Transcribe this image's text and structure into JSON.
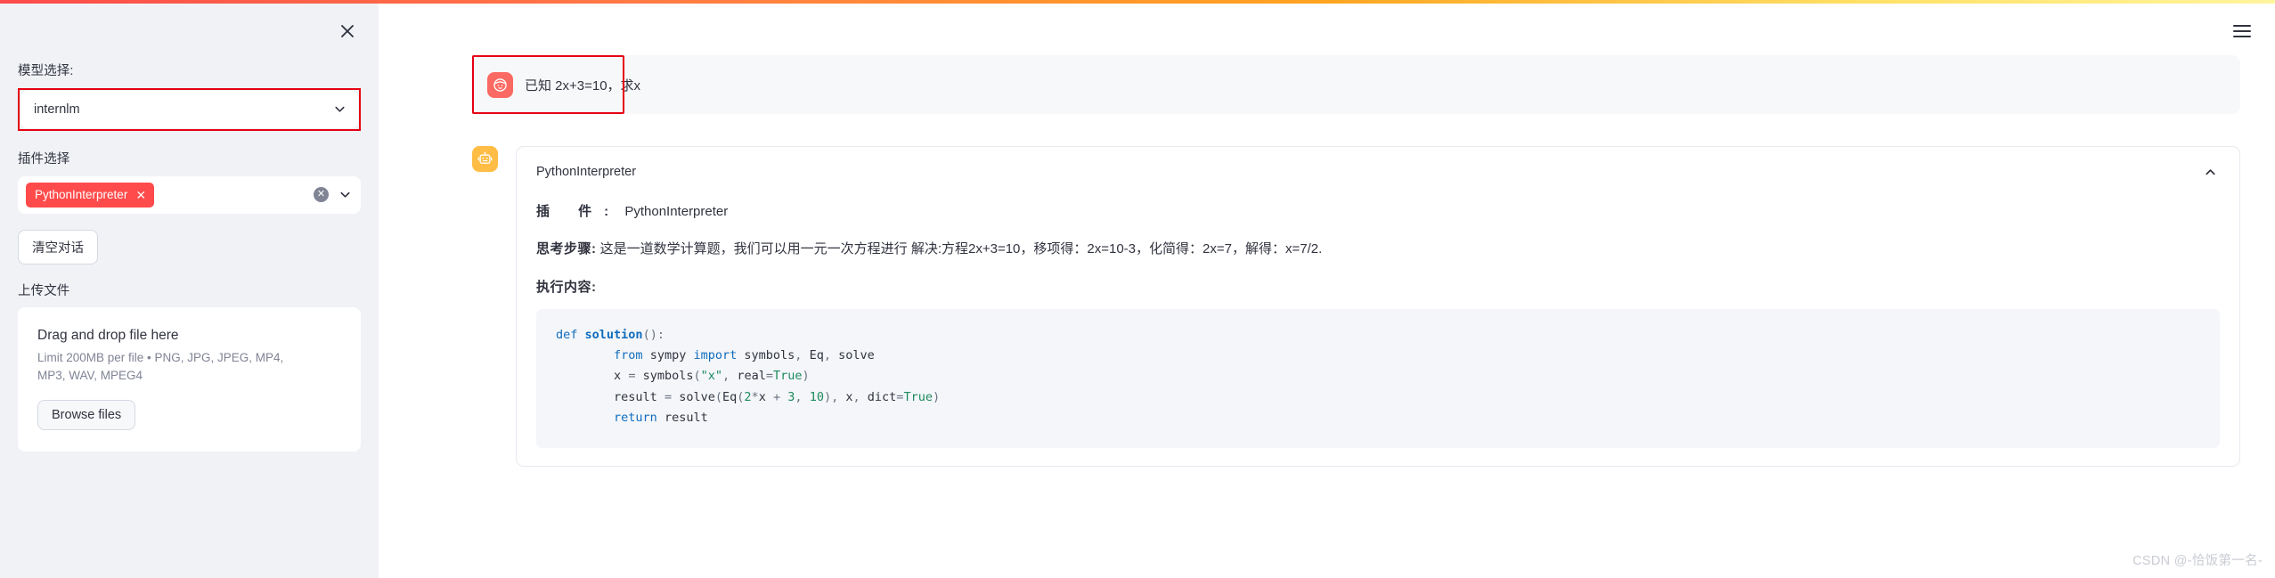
{
  "window": {
    "hamburger_icon": "hamburger-menu-icon",
    "top_accent_colors": [
      "#ff4b4b",
      "#ffa421",
      "#fff59d"
    ]
  },
  "sidebar": {
    "close_icon": "close-icon",
    "model": {
      "label": "模型选择:",
      "selected": "internlm",
      "arrow_icon": "chevron-down-icon",
      "annotation_color": "#e60012"
    },
    "plugins": {
      "label": "插件选择",
      "tags": [
        "PythonInterpreter"
      ],
      "tag_remove_icon": "close-icon",
      "clear_icon": "clear-all-icon",
      "arrow_icon": "chevron-down-icon",
      "tag_color": "#ff4b4b"
    },
    "clear_conversation_label": "清空对话",
    "upload": {
      "label": "上传文件",
      "dropzone_title": "Drag and drop file here",
      "dropzone_hint": "Limit 200MB per file • PNG, JPG, JPEG, MP4, MP3, WAV, MPEG4",
      "browse_label": "Browse files"
    }
  },
  "chat": {
    "user_message": {
      "avatar_icon": "user-face-avatar-icon",
      "avatar_color": "#fa6a63",
      "text": "已知 2x+3=10，求x",
      "annotation_color": "#e60012"
    },
    "assistant_message": {
      "avatar_icon": "robot-avatar-icon",
      "avatar_color": "#ffbd45",
      "expander_title": "PythonInterpreter",
      "collapse_icon": "chevron-up-icon",
      "fields": [
        {
          "key": "插   件:",
          "value": "PythonInterpreter"
        },
        {
          "key": "思考步骤:",
          "value": "这是一道数学计算题，我们可以用一元一次方程进行 解决:方程2x+3=10，移项得：2x=10-3，化简得：2x=7，解得：x=7/2."
        }
      ],
      "exec_label": "执行内容:",
      "code_title": "python",
      "code_lines": [
        "def solution():",
        "        from sympy import symbols, Eq, solve",
        "        x = symbols(\"x\", real=True)",
        "        result = solve(Eq(2*x + 3, 10), x, dict=True)",
        "        return result"
      ]
    }
  },
  "watermark": "CSDN @-恰饭第一名-"
}
